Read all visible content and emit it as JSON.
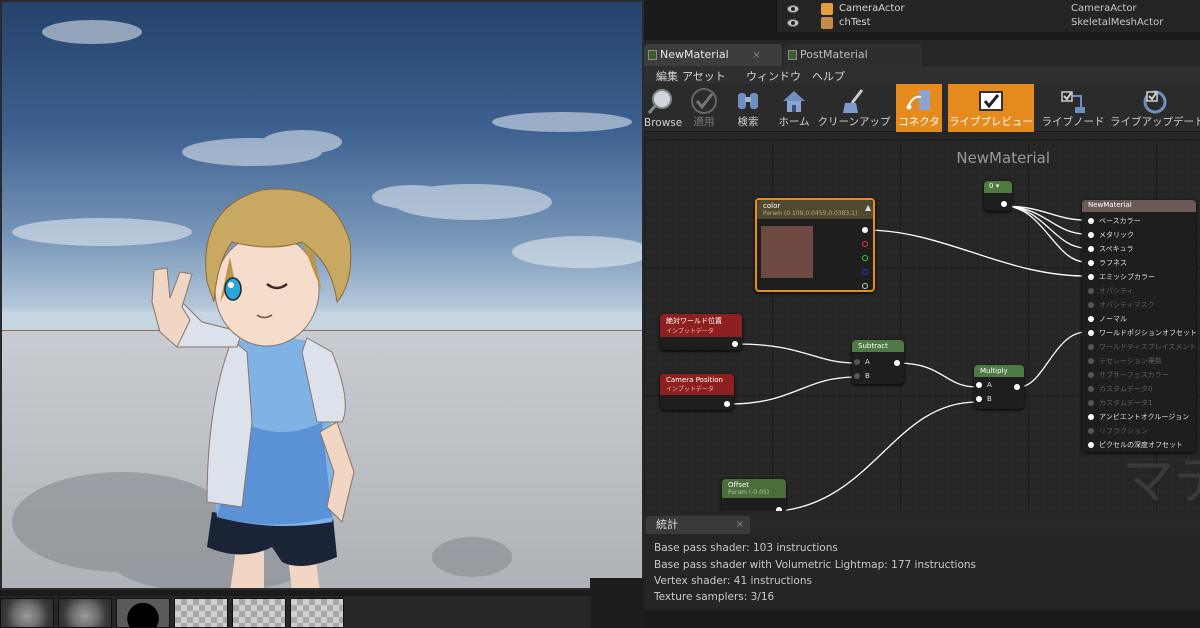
{
  "outliner": {
    "rows": [
      {
        "name": "CameraActor",
        "type": "CameraActor"
      },
      {
        "name": "chTest",
        "type": "SkeletalMeshActor"
      }
    ]
  },
  "editor": {
    "tabs": [
      {
        "label": "NewMaterial",
        "active": true
      },
      {
        "label": "PostMaterial",
        "active": false
      }
    ],
    "tab_close": "×",
    "menu": [
      "編集",
      "アセット",
      "ウィンドウ",
      "ヘルプ"
    ],
    "toolbar": [
      {
        "label": "Browse",
        "icon": "magnifier-icon"
      },
      {
        "label": "適用",
        "icon": "checkmark-icon",
        "disabled": true
      },
      {
        "label": "検索",
        "icon": "binoculars-icon"
      },
      {
        "label": "ホーム",
        "icon": "house-icon"
      },
      {
        "label": "クリーンアップ",
        "icon": "broom-icon"
      },
      {
        "label": "コネクタ",
        "icon": "connector-icon",
        "highlighted": true
      },
      {
        "label": "ライブプレビュー",
        "icon": "live-preview-icon",
        "highlighted": true
      },
      {
        "label": "ライブノード",
        "icon": "live-node-icon"
      },
      {
        "label": "ライブアップデート",
        "icon": "live-update-icon"
      }
    ],
    "graph_title": "NewMaterial",
    "watermark": "マテ",
    "nodes": {
      "const0": {
        "label": "0"
      },
      "color": {
        "title": "color",
        "sub": "Param (0.109,0.0459,0.0383,1)",
        "swatch": "#6e4a43"
      },
      "worldpos": {
        "title": "絶対ワールド位置",
        "sub": "インプットデータ"
      },
      "campos": {
        "title": "Camera Position",
        "sub": "インプットデータ"
      },
      "subtract": {
        "title": "Subtract",
        "a": "A",
        "b": "B"
      },
      "multiply": {
        "title": "Multiply",
        "a": "A",
        "b": "B"
      },
      "offset": {
        "title": "Offset",
        "sub": "Param (-0.05)"
      },
      "result": {
        "title": "NewMaterial",
        "inputs": [
          {
            "label": "ベースカラー",
            "on": true
          },
          {
            "label": "メタリック",
            "on": true
          },
          {
            "label": "スペキュラ",
            "on": true
          },
          {
            "label": "ラフネス",
            "on": true
          },
          {
            "label": "エミッシブカラー",
            "on": true
          },
          {
            "label": "オパシティ",
            "on": false
          },
          {
            "label": "オパシティマスク",
            "on": false
          },
          {
            "label": "ノーマル",
            "on": true
          },
          {
            "label": "ワールドポジションオフセット",
            "on": true
          },
          {
            "label": "ワールドディスプレイスメント",
            "on": false
          },
          {
            "label": "テセレーション乗数",
            "on": false
          },
          {
            "label": "サブサーフェスカラー",
            "on": false
          },
          {
            "label": "カスタムデータ0",
            "on": false
          },
          {
            "label": "カスタムデータ1",
            "on": false
          },
          {
            "label": "アンビエントオクルージョン",
            "on": true
          },
          {
            "label": "リフラクション",
            "on": false
          },
          {
            "label": "ピクセルの深度オフセット",
            "on": true
          }
        ]
      }
    },
    "stats": {
      "tab": "統計",
      "close": "×",
      "lines": [
        "Base pass shader: 103 instructions",
        "Base pass shader with Volumetric Lightmap: 177 instructions",
        "Vertex shader: 41 instructions",
        "Texture samplers: 3/16"
      ]
    }
  }
}
